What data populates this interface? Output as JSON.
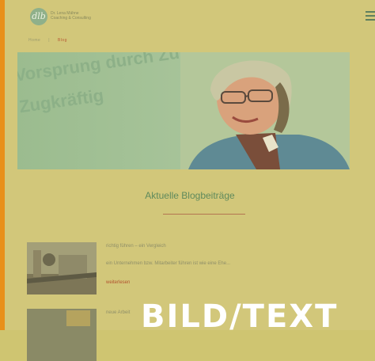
{
  "header": {
    "logo_mark": "dlb",
    "logo_line1": "Dr. Lena Mähne",
    "logo_line2": "Coaching & Consulting",
    "menu_icon": "hamburger-menu-icon"
  },
  "breadcrumb": {
    "home": "Home",
    "separator": "|",
    "current": "Blog"
  },
  "hero": {
    "line1": "Vorsprung durch Zufriedenheit",
    "line2": "Zugkräftig"
  },
  "section": {
    "title": "Aktuelle Blogbeiträge"
  },
  "posts": [
    {
      "title": "richtig führen – ein Vergleich",
      "excerpt": "ein Unternehmen bzw. Mitarbeiter führen ist wie eine Ehe...",
      "more": "weiterlesen"
    },
    {
      "title": "neue Arbeit",
      "excerpt": "",
      "more": ""
    }
  ],
  "overlay": {
    "text": "BILD/TEXT"
  },
  "colors": {
    "accent_orange": "#e8901a",
    "heading_green": "#5f8a5c",
    "link_red": "#b2532f"
  }
}
